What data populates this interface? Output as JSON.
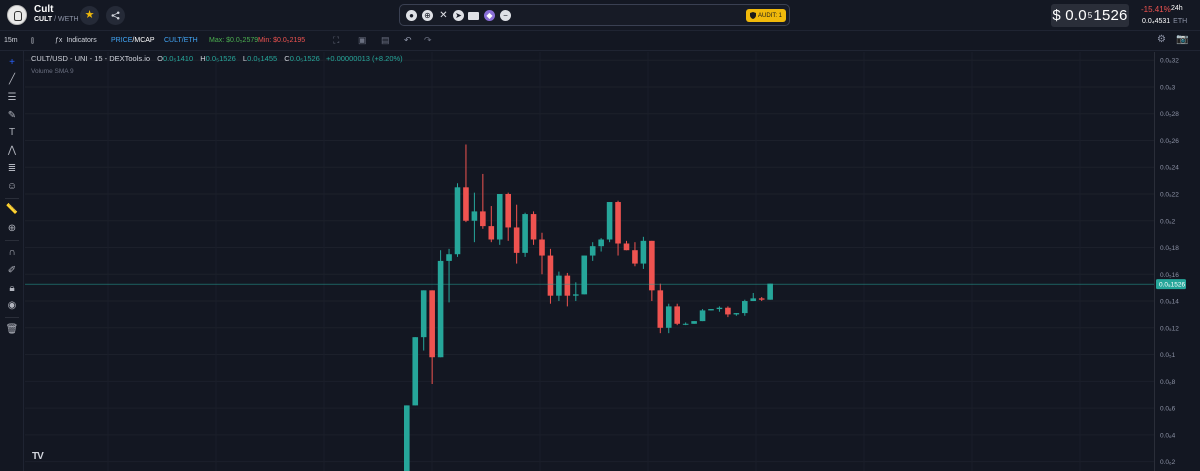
{
  "header": {
    "token_name": "Cult",
    "pair_base": "CULT",
    "pair_sep": " / ",
    "pair_quote": "WETH",
    "links": [
      "coingecko-icon",
      "website-icon",
      "x-icon",
      "telegram-icon",
      "email-icon",
      "etherscan-icon",
      "more-icon"
    ],
    "audit_label": "AUDIT: 1",
    "price_prefix": "$ 0.0",
    "price_zeros": "5",
    "price_digits": "1526",
    "change": "-15.41%",
    "change_period": "24h",
    "eth_price_value": "0.0₄4531",
    "eth_price_unit": "ETH"
  },
  "toolbar": {
    "interval": "15m",
    "indicators_label": "Indicators",
    "price_label": "PRICE",
    "price_sep": "/",
    "mcap_label": "MCAP",
    "cult_eth_label": "CULT/ETH",
    "max_label": "Max: $0.0₅2579",
    "min_label": "Min: $0.0₅2195"
  },
  "legend": {
    "symbol": "CULT/USD - UNI - 15 - DEXTools.io",
    "o_label": "O",
    "o_value": "0.0₅1410",
    "h_label": "H",
    "h_value": "0.0₅1526",
    "l_label": "L",
    "l_value": "0.0₅1455",
    "c_label": "C",
    "c_value": "0.0₅1526",
    "change": "+0.00000013 (+8.20%)",
    "volume": "Volume SMA 9"
  },
  "axis": {
    "price_label_value": "0.0₅1526",
    "up_color": "#26a69a",
    "down_color": "#ef5350",
    "price_line_color": "#26a69a"
  },
  "chart_data": {
    "type": "candlestick",
    "y_tick_labels": [
      "0.0₅32",
      "0.0₅3",
      "0.0₅28",
      "0.0₅26",
      "0.0₅24",
      "0.0₅22",
      "0.0₅2",
      "0.0₅18",
      "0.0₅16",
      "0.0₅14",
      "0.0₅12",
      "0.0₅1",
      "0.0₆8",
      "0.0₆6",
      "0.0₆4",
      "0.0₆2"
    ],
    "y_tick_values": [
      3.2,
      3.0,
      2.8,
      2.6,
      2.4,
      2.2,
      2.0,
      1.8,
      1.6,
      1.4,
      1.2,
      1.0,
      0.8,
      0.6,
      0.4,
      0.2
    ],
    "unit_note": "prices in units of 1e-6 USD",
    "ylim": [
      0.13,
      3.32
    ],
    "last_price": 1.526,
    "candles": [
      {
        "o": 0.0,
        "h": 0.62,
        "l": 0.0,
        "c": 0.62
      },
      {
        "o": 0.62,
        "h": 1.13,
        "l": 0.62,
        "c": 1.13
      },
      {
        "o": 1.13,
        "h": 1.48,
        "l": 1.03,
        "c": 1.48
      },
      {
        "o": 1.48,
        "h": 1.48,
        "l": 0.78,
        "c": 0.98
      },
      {
        "o": 0.98,
        "h": 1.78,
        "l": 0.98,
        "c": 1.7
      },
      {
        "o": 1.7,
        "h": 1.79,
        "l": 1.39,
        "c": 1.75
      },
      {
        "o": 1.75,
        "h": 2.28,
        "l": 1.73,
        "c": 2.25
      },
      {
        "o": 2.25,
        "h": 2.57,
        "l": 1.99,
        "c": 2.0
      },
      {
        "o": 2.0,
        "h": 2.21,
        "l": 1.84,
        "c": 2.07
      },
      {
        "o": 2.07,
        "h": 2.35,
        "l": 1.94,
        "c": 1.96
      },
      {
        "o": 1.96,
        "h": 2.11,
        "l": 1.84,
        "c": 1.86
      },
      {
        "o": 1.86,
        "h": 2.2,
        "l": 1.82,
        "c": 2.2
      },
      {
        "o": 2.2,
        "h": 2.21,
        "l": 1.85,
        "c": 1.95
      },
      {
        "o": 1.95,
        "h": 2.12,
        "l": 1.68,
        "c": 1.76
      },
      {
        "o": 1.76,
        "h": 2.06,
        "l": 1.73,
        "c": 2.05
      },
      {
        "o": 2.05,
        "h": 2.07,
        "l": 1.82,
        "c": 1.86
      },
      {
        "o": 1.86,
        "h": 1.91,
        "l": 1.6,
        "c": 1.74
      },
      {
        "o": 1.74,
        "h": 1.79,
        "l": 1.38,
        "c": 1.44
      },
      {
        "o": 1.44,
        "h": 1.62,
        "l": 1.4,
        "c": 1.59
      },
      {
        "o": 1.59,
        "h": 1.61,
        "l": 1.36,
        "c": 1.44
      },
      {
        "o": 1.44,
        "h": 1.54,
        "l": 1.4,
        "c": 1.45
      },
      {
        "o": 1.45,
        "h": 1.74,
        "l": 1.45,
        "c": 1.74
      },
      {
        "o": 1.74,
        "h": 1.84,
        "l": 1.7,
        "c": 1.81
      },
      {
        "o": 1.81,
        "h": 1.87,
        "l": 1.77,
        "c": 1.86
      },
      {
        "o": 1.86,
        "h": 2.14,
        "l": 1.84,
        "c": 2.14
      },
      {
        "o": 2.14,
        "h": 2.15,
        "l": 1.74,
        "c": 1.83
      },
      {
        "o": 1.83,
        "h": 1.85,
        "l": 1.78,
        "c": 1.78
      },
      {
        "o": 1.78,
        "h": 1.84,
        "l": 1.66,
        "c": 1.68
      },
      {
        "o": 1.68,
        "h": 1.88,
        "l": 1.64,
        "c": 1.85
      },
      {
        "o": 1.85,
        "h": 1.85,
        "l": 1.4,
        "c": 1.48
      },
      {
        "o": 1.48,
        "h": 1.53,
        "l": 1.16,
        "c": 1.2
      },
      {
        "o": 1.2,
        "h": 1.38,
        "l": 1.16,
        "c": 1.36
      },
      {
        "o": 1.36,
        "h": 1.38,
        "l": 1.22,
        "c": 1.23
      },
      {
        "o": 1.23,
        "h": 1.24,
        "l": 1.22,
        "c": 1.23
      },
      {
        "o": 1.23,
        "h": 1.25,
        "l": 1.23,
        "c": 1.25
      },
      {
        "o": 1.25,
        "h": 1.34,
        "l": 1.25,
        "c": 1.33
      },
      {
        "o": 1.33,
        "h": 1.34,
        "l": 1.33,
        "c": 1.34
      },
      {
        "o": 1.34,
        "h": 1.36,
        "l": 1.32,
        "c": 1.35
      },
      {
        "o": 1.35,
        "h": 1.36,
        "l": 1.28,
        "c": 1.3
      },
      {
        "o": 1.3,
        "h": 1.31,
        "l": 1.29,
        "c": 1.31
      },
      {
        "o": 1.31,
        "h": 1.41,
        "l": 1.29,
        "c": 1.4
      },
      {
        "o": 1.4,
        "h": 1.46,
        "l": 1.4,
        "c": 1.42
      },
      {
        "o": 1.42,
        "h": 1.43,
        "l": 1.4,
        "c": 1.41
      },
      {
        "o": 1.41,
        "h": 1.53,
        "l": 1.41,
        "c": 1.53
      }
    ]
  }
}
